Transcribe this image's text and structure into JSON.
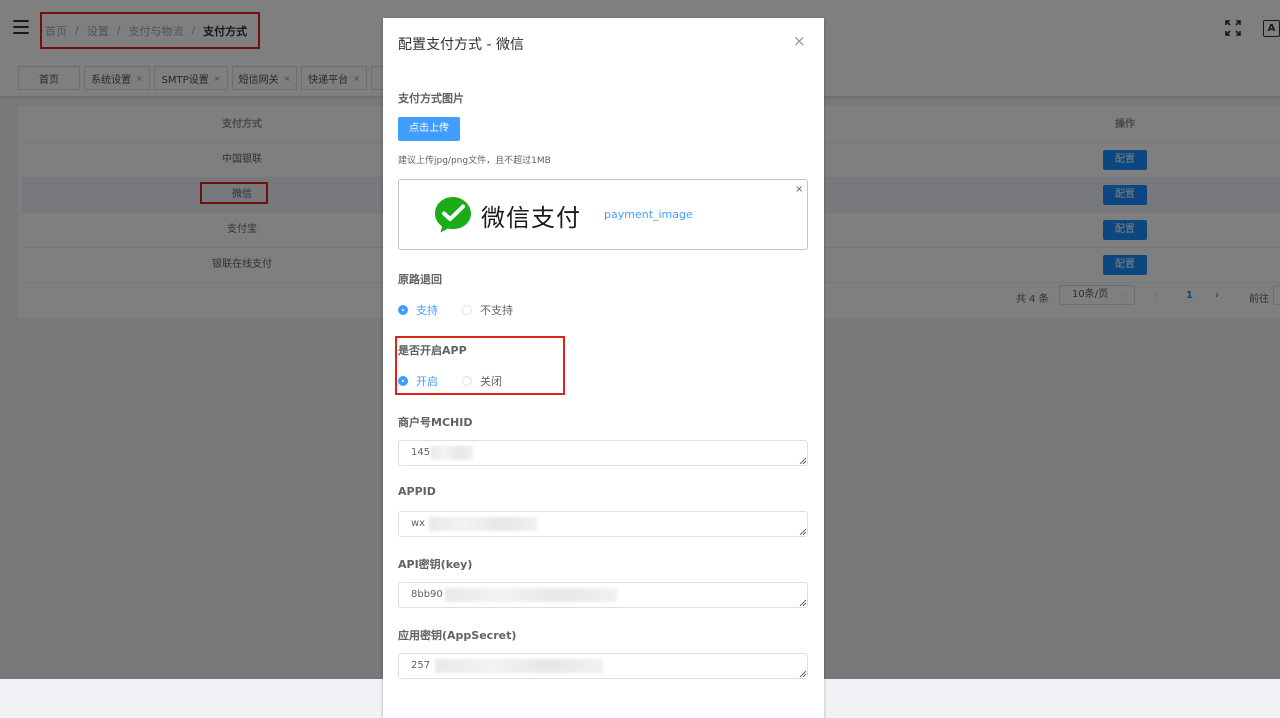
{
  "breadcrumb": [
    "首页",
    "设置",
    "支付与物流"
  ],
  "breadcrumb_current": "支付方式",
  "header_icons": [
    "fullscreen-icon",
    "font-size-icon"
  ],
  "header_font_icon_text": "A",
  "tags": [
    {
      "label": "首页",
      "closable": false
    },
    {
      "label": "系统设置",
      "closable": true
    },
    {
      "label": "SMTP设置",
      "closable": true
    },
    {
      "label": "短信网关",
      "closable": true
    },
    {
      "label": "快递平台",
      "closable": true
    }
  ],
  "tag_close_glyph": "×",
  "table": {
    "headers": [
      "支付方式",
      "操作"
    ],
    "rows": [
      {
        "name": "中国银联",
        "action": "配置"
      },
      {
        "name": "微信",
        "action": "配置"
      },
      {
        "name": "支付宝",
        "action": "配置"
      },
      {
        "name": "银联在线支付",
        "action": "配置"
      }
    ]
  },
  "pagination": {
    "total": "共 4 条",
    "page_size": "10条/页",
    "current": "1",
    "goto": "前往",
    "prev": "‹",
    "next": "›",
    "dropdown": "⌵"
  },
  "dialog": {
    "title": "配置支付方式 - 微信",
    "close": "×",
    "image_label": "支付方式图片",
    "upload_button": "点击上传",
    "upload_tip": "建议上传jpg/png文件，且不超过1MB",
    "image_logo_text": "微信支付",
    "image_caption": "payment_image",
    "image_remove": "×",
    "refund_label": "原路退回",
    "refund_options": [
      "支持",
      "不支持"
    ],
    "app_label": "是否开启APP",
    "app_options": [
      "开启",
      "关闭"
    ],
    "mchid_label": "商户号MCHID",
    "mchid_value": "145",
    "appid_label": "APPID",
    "appid_value": "wx",
    "apikey_label": "API密钥(key)",
    "apikey_value": "8bb90",
    "appsecret_label": "应用密钥(AppSecret)",
    "appsecret_value": "257"
  },
  "colors": {
    "primary": "#409eff",
    "button": "#1890ff",
    "highlight_border": "#e0201a",
    "wechat_green": "#1aad19"
  }
}
